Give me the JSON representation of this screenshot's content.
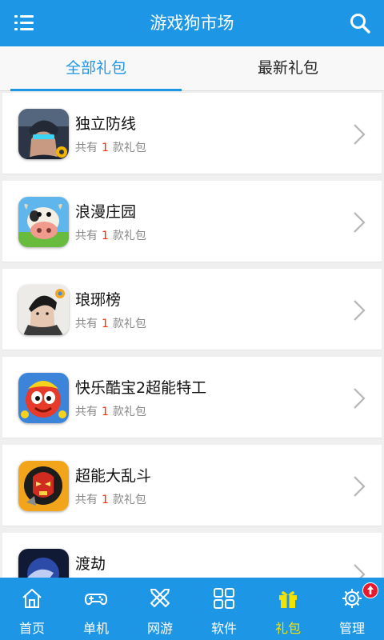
{
  "header": {
    "title": "游戏狗市场"
  },
  "tabs": [
    {
      "label": "全部礼包",
      "active": true
    },
    {
      "label": "最新礼包",
      "active": false
    }
  ],
  "gift_list": {
    "count_prefix": "共有",
    "count_suffix": "款礼包",
    "items": [
      {
        "name": "独立防线",
        "count": "1"
      },
      {
        "name": "浪漫庄园",
        "count": "1"
      },
      {
        "name": "琅琊榜",
        "count": "1"
      },
      {
        "name": "快乐酷宝2超能特工",
        "count": "1"
      },
      {
        "name": "超能大乱斗",
        "count": "1"
      },
      {
        "name": "渡劫",
        "count": ""
      }
    ]
  },
  "bottom_nav": [
    {
      "label": "首页",
      "icon": "home-icon"
    },
    {
      "label": "单机",
      "icon": "gamepad-icon"
    },
    {
      "label": "网游",
      "icon": "crossed-swords-icon"
    },
    {
      "label": "软件",
      "icon": "grid-icon"
    },
    {
      "label": "礼包",
      "icon": "gift-icon",
      "active": true
    },
    {
      "label": "管理",
      "icon": "gear-icon",
      "badge": true
    }
  ],
  "colors": {
    "primary": "#1e96e6",
    "active_nav": "#f2e400",
    "count_number": "#ff2a00",
    "badge": "#e8192c"
  }
}
